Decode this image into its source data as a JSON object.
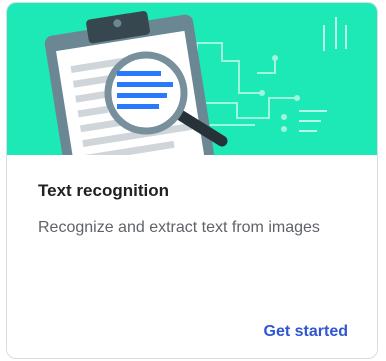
{
  "card": {
    "title": "Text recognition",
    "description": "Recognize and extract text from images",
    "cta_label": "Get started"
  },
  "hero": {
    "illustration": "clipboard-with-magnifier",
    "background_color": "#1de9b6"
  },
  "colors": {
    "accent": "#3056d3",
    "title_text": "#202124",
    "body_text": "#5f6368"
  }
}
